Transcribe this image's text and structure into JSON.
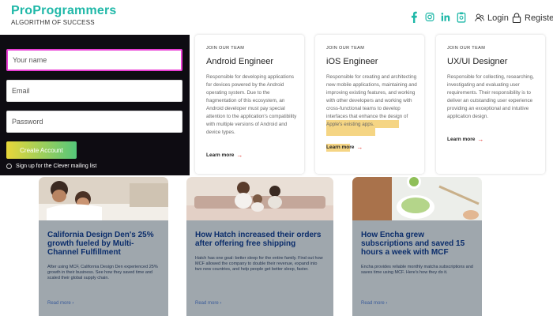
{
  "header": {
    "logo_name": "ProProgrammers",
    "logo_tagline": "ALGORITHM OF SUCCESS",
    "socials": [
      "facebook-icon",
      "instagram-icon",
      "linkedin-icon",
      "clipboard-icon"
    ],
    "login_label": "Login",
    "register_label": "Register"
  },
  "signup": {
    "name_placeholder": "Your name",
    "email_placeholder": "Email",
    "password_placeholder": "Password",
    "create_label": "Create Account",
    "mailing_label": "Sign up for the Clever mailing list"
  },
  "jobs": [
    {
      "eyebrow": "JOIN OUR TEAM",
      "title": "Android Engineer",
      "description": "Responsible for developing applications for devices powered by the Android operating system. Due to the fragmentation of this ecosystem, an Android developer must pay special attention to the application's compatibility with multiple versions of Android and device types.",
      "link": "Learn more"
    },
    {
      "eyebrow": "JOIN OUR TEAM",
      "title": "iOS Engineer",
      "description": "Responsible for creating and architecting new mobile applications, maintaining and improving existing features, and working with other developers and working with cross-functional teams to develop interfaces that enhance the design of Apple's existing apps.",
      "link": "Learn more"
    },
    {
      "eyebrow": "JOIN OUR TEAM",
      "title": "UX/UI Designer",
      "description": "Responsible for collecting, researching, investigating and evaluating user requirements. Their responsibility is to deliver an outstanding user experience providing an exceptional and intuitive application design.",
      "link": "Learn more"
    }
  ],
  "cases": [
    {
      "title": "California Design Den's 25% growth fueled by Multi-Channel Fulfillment",
      "description": "After using MCF, California Design Den experienced 25% growth in their business. See how they saved time and scaled their global supply chain.",
      "link": "Read more ›"
    },
    {
      "title": "How Hatch increased their orders after offering free shipping",
      "description": "Hatch has one goal: better sleep for the entire family. Find out how MCF allowed the company to double their revenue, expand into two new countries, and help people get better sleep, faster.",
      "link": "Read more ›"
    },
    {
      "title": "How Encha grew subscriptions and saved 15 hours a week with MCF",
      "description": "Encha provides reliable monthly matcha subscriptions and saves time using MCF. Here's how they do it.",
      "link": "Read more ›"
    }
  ],
  "colors": {
    "brand": "#1fb8a8",
    "case_panel": "#9fa7ad",
    "case_title": "#0b2d6b",
    "highlight": "#f3ce6e"
  }
}
